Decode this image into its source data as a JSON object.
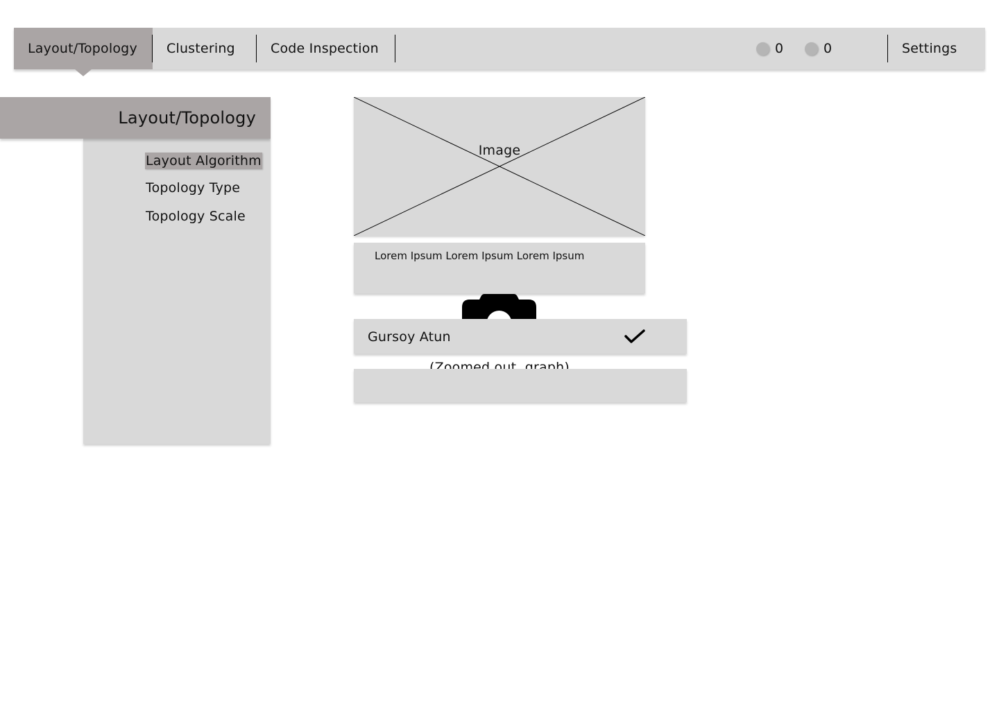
{
  "nav": {
    "tabs": [
      {
        "label": "Layout/Topology",
        "active": true
      },
      {
        "label": "Clustering",
        "active": false
      },
      {
        "label": "Code Inspection",
        "active": false
      }
    ],
    "counters": [
      {
        "icon": "status-dot-icon",
        "value": "0"
      },
      {
        "icon": "status-dot-icon",
        "value": "0"
      }
    ],
    "settings_label": "Settings"
  },
  "sidebar": {
    "title": "Layout/Topology",
    "items": [
      {
        "label": "Layout Algorithm",
        "active": true
      },
      {
        "label": "Topology Type",
        "active": false
      },
      {
        "label": "Topology Scale",
        "active": false
      }
    ]
  },
  "main": {
    "image_placeholder": {
      "label": "Image"
    },
    "description": "Lorem Ipsum Lorem Ipsum Lorem Ipsum",
    "graph_caption": "(Zoomed out, graph)",
    "camera_icon": "camera-icon",
    "user_row": {
      "name": "Gursoy Atun",
      "icon": "check-icon"
    }
  },
  "colors": {
    "panel_bg": "#d9d9d9",
    "active_bg": "#aaa5a5",
    "page_bg": "#ffffff",
    "text": "#111111"
  }
}
